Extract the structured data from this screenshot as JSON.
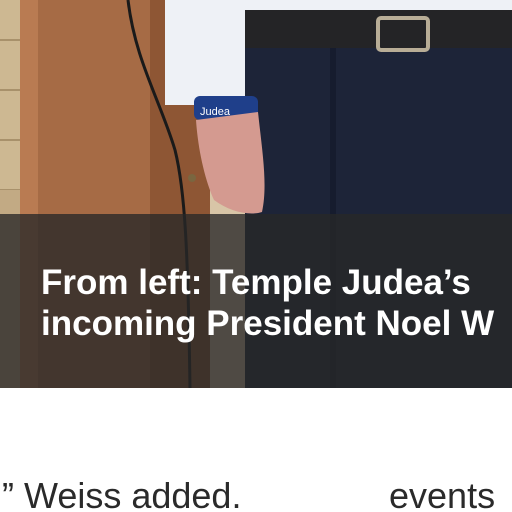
{
  "caption": {
    "line1": "From left: Temple Judea’s",
    "line2": "incoming President Noel W"
  },
  "wristband_text": "Judea",
  "body_text": {
    "left": ",” Weiss added.",
    "right": "events"
  }
}
